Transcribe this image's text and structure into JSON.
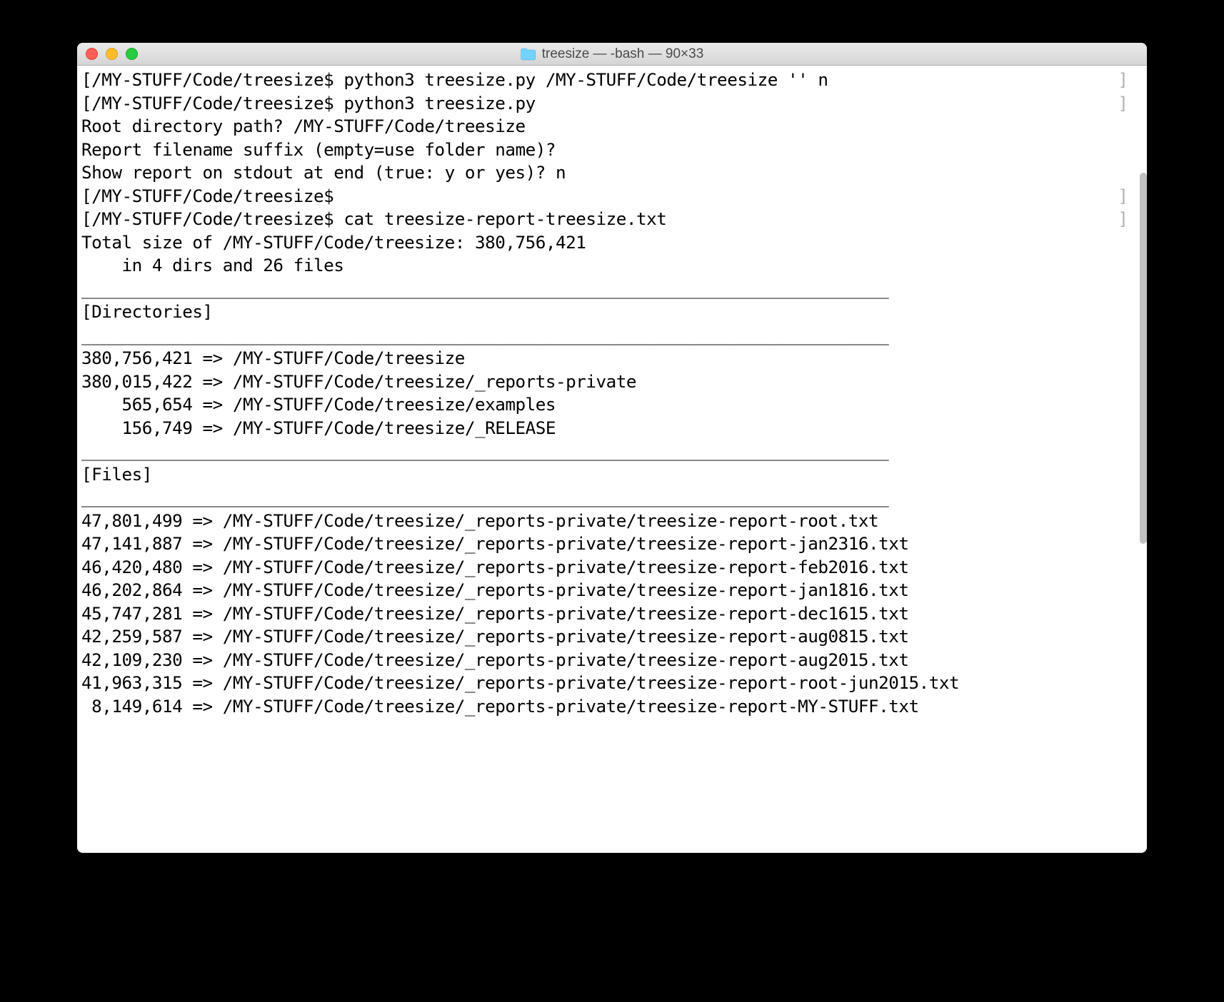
{
  "window": {
    "title": "treesize — -bash — 90×33"
  },
  "terminal": {
    "lines": [
      "[/MY-STUFF/Code/treesize$ python3 treesize.py /MY-STUFF/Code/treesize '' n",
      "[/MY-STUFF/Code/treesize$ python3 treesize.py",
      "Root directory path? /MY-STUFF/Code/treesize",
      "Report filename suffix (empty=use folder name)?",
      "Show report on stdout at end (true: y or yes)? n",
      "[/MY-STUFF/Code/treesize$",
      "[/MY-STUFF/Code/treesize$ cat treesize-report-treesize.txt",
      "",
      "Total size of /MY-STUFF/Code/treesize: 380,756,421",
      "    in 4 dirs and 26 files",
      "",
      "________________________________________________________________________________",
      "[Directories]",
      "________________________________________________________________________________",
      "",
      "380,756,421 => /MY-STUFF/Code/treesize",
      "380,015,422 => /MY-STUFF/Code/treesize/_reports-private",
      "    565,654 => /MY-STUFF/Code/treesize/examples",
      "    156,749 => /MY-STUFF/Code/treesize/_RELEASE",
      "",
      "________________________________________________________________________________",
      "[Files]",
      "________________________________________________________________________________",
      "",
      "47,801,499 => /MY-STUFF/Code/treesize/_reports-private/treesize-report-root.txt",
      "47,141,887 => /MY-STUFF/Code/treesize/_reports-private/treesize-report-jan2316.txt",
      "46,420,480 => /MY-STUFF/Code/treesize/_reports-private/treesize-report-feb2016.txt",
      "46,202,864 => /MY-STUFF/Code/treesize/_reports-private/treesize-report-jan1816.txt",
      "45,747,281 => /MY-STUFF/Code/treesize/_reports-private/treesize-report-dec1615.txt",
      "42,259,587 => /MY-STUFF/Code/treesize/_reports-private/treesize-report-aug0815.txt",
      "42,109,230 => /MY-STUFF/Code/treesize/_reports-private/treesize-report-aug2015.txt",
      "41,963,315 => /MY-STUFF/Code/treesize/_reports-private/treesize-report-root-jun2015.txt",
      " 8,149,614 => /MY-STUFF/Code/treesize/_reports-private/treesize-report-MY-STUFF.txt"
    ],
    "right_brackets_at": [
      0,
      1,
      5,
      6
    ]
  }
}
